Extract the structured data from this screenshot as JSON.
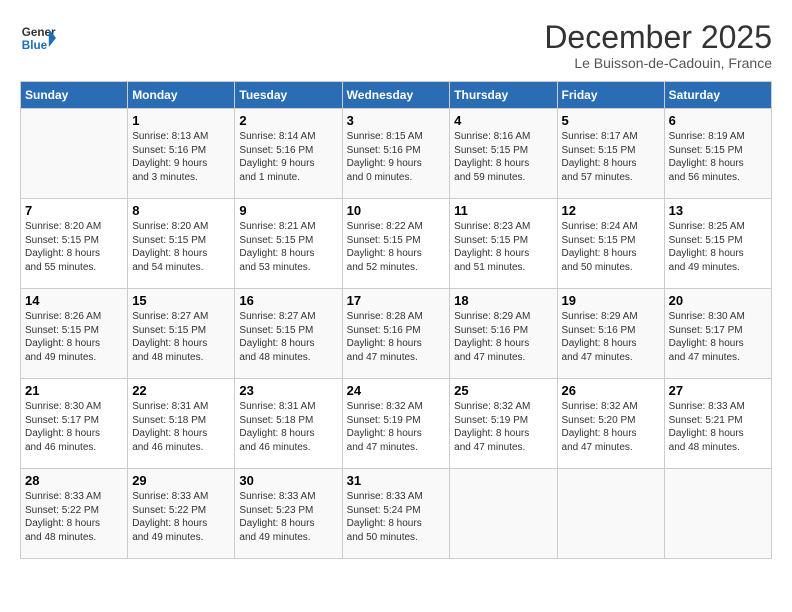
{
  "logo": {
    "line1": "General",
    "line2": "Blue"
  },
  "title": "December 2025",
  "location": "Le Buisson-de-Cadouin, France",
  "days_of_week": [
    "Sunday",
    "Monday",
    "Tuesday",
    "Wednesday",
    "Thursday",
    "Friday",
    "Saturday"
  ],
  "weeks": [
    [
      {
        "day": "",
        "info": ""
      },
      {
        "day": "1",
        "info": "Sunrise: 8:13 AM\nSunset: 5:16 PM\nDaylight: 9 hours\nand 3 minutes."
      },
      {
        "day": "2",
        "info": "Sunrise: 8:14 AM\nSunset: 5:16 PM\nDaylight: 9 hours\nand 1 minute."
      },
      {
        "day": "3",
        "info": "Sunrise: 8:15 AM\nSunset: 5:16 PM\nDaylight: 9 hours\nand 0 minutes."
      },
      {
        "day": "4",
        "info": "Sunrise: 8:16 AM\nSunset: 5:15 PM\nDaylight: 8 hours\nand 59 minutes."
      },
      {
        "day": "5",
        "info": "Sunrise: 8:17 AM\nSunset: 5:15 PM\nDaylight: 8 hours\nand 57 minutes."
      },
      {
        "day": "6",
        "info": "Sunrise: 8:19 AM\nSunset: 5:15 PM\nDaylight: 8 hours\nand 56 minutes."
      }
    ],
    [
      {
        "day": "7",
        "info": "Sunrise: 8:20 AM\nSunset: 5:15 PM\nDaylight: 8 hours\nand 55 minutes."
      },
      {
        "day": "8",
        "info": "Sunrise: 8:20 AM\nSunset: 5:15 PM\nDaylight: 8 hours\nand 54 minutes."
      },
      {
        "day": "9",
        "info": "Sunrise: 8:21 AM\nSunset: 5:15 PM\nDaylight: 8 hours\nand 53 minutes."
      },
      {
        "day": "10",
        "info": "Sunrise: 8:22 AM\nSunset: 5:15 PM\nDaylight: 8 hours\nand 52 minutes."
      },
      {
        "day": "11",
        "info": "Sunrise: 8:23 AM\nSunset: 5:15 PM\nDaylight: 8 hours\nand 51 minutes."
      },
      {
        "day": "12",
        "info": "Sunrise: 8:24 AM\nSunset: 5:15 PM\nDaylight: 8 hours\nand 50 minutes."
      },
      {
        "day": "13",
        "info": "Sunrise: 8:25 AM\nSunset: 5:15 PM\nDaylight: 8 hours\nand 49 minutes."
      }
    ],
    [
      {
        "day": "14",
        "info": "Sunrise: 8:26 AM\nSunset: 5:15 PM\nDaylight: 8 hours\nand 49 minutes."
      },
      {
        "day": "15",
        "info": "Sunrise: 8:27 AM\nSunset: 5:15 PM\nDaylight: 8 hours\nand 48 minutes."
      },
      {
        "day": "16",
        "info": "Sunrise: 8:27 AM\nSunset: 5:15 PM\nDaylight: 8 hours\nand 48 minutes."
      },
      {
        "day": "17",
        "info": "Sunrise: 8:28 AM\nSunset: 5:16 PM\nDaylight: 8 hours\nand 47 minutes."
      },
      {
        "day": "18",
        "info": "Sunrise: 8:29 AM\nSunset: 5:16 PM\nDaylight: 8 hours\nand 47 minutes."
      },
      {
        "day": "19",
        "info": "Sunrise: 8:29 AM\nSunset: 5:16 PM\nDaylight: 8 hours\nand 47 minutes."
      },
      {
        "day": "20",
        "info": "Sunrise: 8:30 AM\nSunset: 5:17 PM\nDaylight: 8 hours\nand 47 minutes."
      }
    ],
    [
      {
        "day": "21",
        "info": "Sunrise: 8:30 AM\nSunset: 5:17 PM\nDaylight: 8 hours\nand 46 minutes."
      },
      {
        "day": "22",
        "info": "Sunrise: 8:31 AM\nSunset: 5:18 PM\nDaylight: 8 hours\nand 46 minutes."
      },
      {
        "day": "23",
        "info": "Sunrise: 8:31 AM\nSunset: 5:18 PM\nDaylight: 8 hours\nand 46 minutes."
      },
      {
        "day": "24",
        "info": "Sunrise: 8:32 AM\nSunset: 5:19 PM\nDaylight: 8 hours\nand 47 minutes."
      },
      {
        "day": "25",
        "info": "Sunrise: 8:32 AM\nSunset: 5:19 PM\nDaylight: 8 hours\nand 47 minutes."
      },
      {
        "day": "26",
        "info": "Sunrise: 8:32 AM\nSunset: 5:20 PM\nDaylight: 8 hours\nand 47 minutes."
      },
      {
        "day": "27",
        "info": "Sunrise: 8:33 AM\nSunset: 5:21 PM\nDaylight: 8 hours\nand 48 minutes."
      }
    ],
    [
      {
        "day": "28",
        "info": "Sunrise: 8:33 AM\nSunset: 5:22 PM\nDaylight: 8 hours\nand 48 minutes."
      },
      {
        "day": "29",
        "info": "Sunrise: 8:33 AM\nSunset: 5:22 PM\nDaylight: 8 hours\nand 49 minutes."
      },
      {
        "day": "30",
        "info": "Sunrise: 8:33 AM\nSunset: 5:23 PM\nDaylight: 8 hours\nand 49 minutes."
      },
      {
        "day": "31",
        "info": "Sunrise: 8:33 AM\nSunset: 5:24 PM\nDaylight: 8 hours\nand 50 minutes."
      },
      {
        "day": "",
        "info": ""
      },
      {
        "day": "",
        "info": ""
      },
      {
        "day": "",
        "info": ""
      }
    ]
  ]
}
